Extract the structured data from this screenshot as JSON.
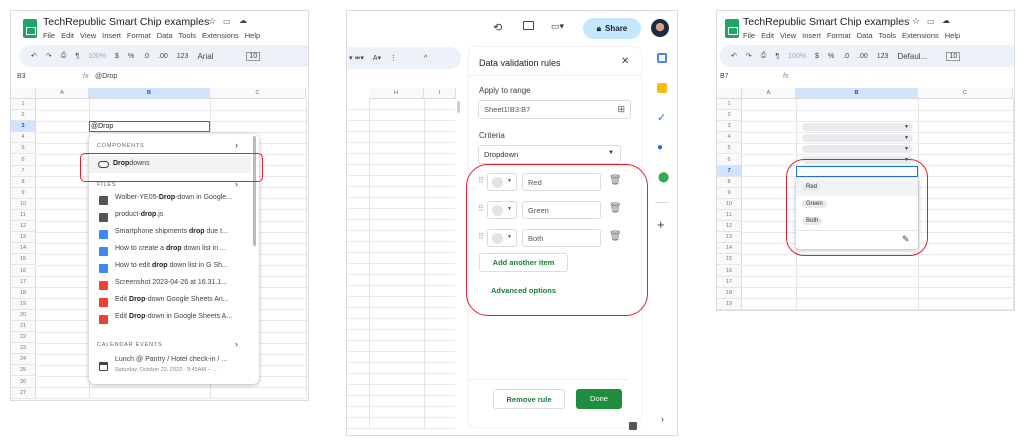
{
  "panel1": {
    "doc_title": "TechRepublic Smart Chip examples",
    "menu": [
      "File",
      "Edit",
      "View",
      "Insert",
      "Format",
      "Data",
      "Tools",
      "Extensions",
      "Help"
    ],
    "toolbar": {
      "zoom": "100%",
      "currency": "$",
      "percent": "%",
      "dec_less": ".0",
      "dec_more": ".00",
      "format": "123",
      "font": "Arial",
      "font_size": "10"
    },
    "cell_ref": "B3",
    "formula": "@Drop",
    "columns": [
      "A",
      "B",
      "C"
    ],
    "rows": [
      "1",
      "2",
      "3",
      "4",
      "5",
      "6",
      "7",
      "8",
      "9",
      "10",
      "11",
      "12",
      "13",
      "14",
      "15",
      "16",
      "17",
      "18",
      "19",
      "20",
      "21",
      "22",
      "23",
      "24",
      "25",
      "26",
      "27"
    ],
    "cell_input": "@Drop",
    "popup": {
      "components_label": "COMPONENTS",
      "dropdowns": {
        "match": "Drop",
        "rest": "downs"
      },
      "files_label": "FILES",
      "files": [
        {
          "pre": "Wolber-YE05-",
          "match": "Drop",
          "post": "-down in Google...",
          "icon": "folder-icon"
        },
        {
          "pre": "product-",
          "match": "drop",
          "post": ".js",
          "icon": "file-icon"
        },
        {
          "pre": "Smartphone shipments ",
          "match": "drop",
          "post": " due t...",
          "icon": "word-doc-icon"
        },
        {
          "pre": "How to create a ",
          "match": "drop",
          "post": " down list in ...",
          "icon": "google-doc-icon"
        },
        {
          "pre": "How to edit ",
          "match": "drop",
          "post": " down list in G Sh...",
          "icon": "google-doc-icon"
        },
        {
          "pre": "Screenshot 2023-04-26 at 16.31.1...",
          "match": "",
          "post": "",
          "icon": "image-icon"
        },
        {
          "pre": "Edit ",
          "match": "Drop",
          "post": "-down Google Sheets An...",
          "icon": "image-icon"
        },
        {
          "pre": "Edit ",
          "match": "Drop",
          "post": "-down in Google Sheets A...",
          "icon": "image-icon"
        }
      ],
      "calendar_label": "CALENDAR EVENTS",
      "event_title": "Lunch @ Pantry / Hotel check-in / ...",
      "event_time": "Saturday, October 22, 2022 · 9:45AM – ..."
    }
  },
  "panel2": {
    "share_label": "Share",
    "columns": [
      "H",
      "I"
    ],
    "sidebar": {
      "title": "Data validation rules",
      "apply_label": "Apply to range",
      "range": "Sheet1!B3:B7",
      "criteria_label": "Criteria",
      "criteria": "Dropdown",
      "items": [
        "Red",
        "Green",
        "Both"
      ],
      "add_item": "Add another item",
      "advanced": "Advanced options",
      "remove": "Remove rule",
      "done": "Done"
    }
  },
  "panel3": {
    "doc_title": "TechRepublic Smart Chip examples",
    "menu": [
      "File",
      "Edit",
      "View",
      "Insert",
      "Format",
      "Data",
      "Tools",
      "Extensions",
      "Help"
    ],
    "toolbar": {
      "zoom": "100%",
      "currency": "$",
      "percent": "%",
      "dec_less": ".0",
      "dec_more": ".00",
      "format": "123",
      "font": "Defaul...",
      "font_size": "10"
    },
    "cell_ref": "B7",
    "columns": [
      "A",
      "B",
      "C"
    ],
    "rows": [
      "1",
      "2",
      "3",
      "4",
      "5",
      "6",
      "7",
      "8",
      "9",
      "10",
      "11",
      "12",
      "13",
      "14",
      "15",
      "16",
      "17",
      "18",
      "19"
    ],
    "options": [
      "Red",
      "Green",
      "Both"
    ]
  },
  "colors": {
    "accent_green": "#188038",
    "done_bg": "#1e8e3e",
    "highlight": "#e5202a",
    "select_blue": "#0b57d0",
    "share_bg": "#c2e7ff"
  }
}
